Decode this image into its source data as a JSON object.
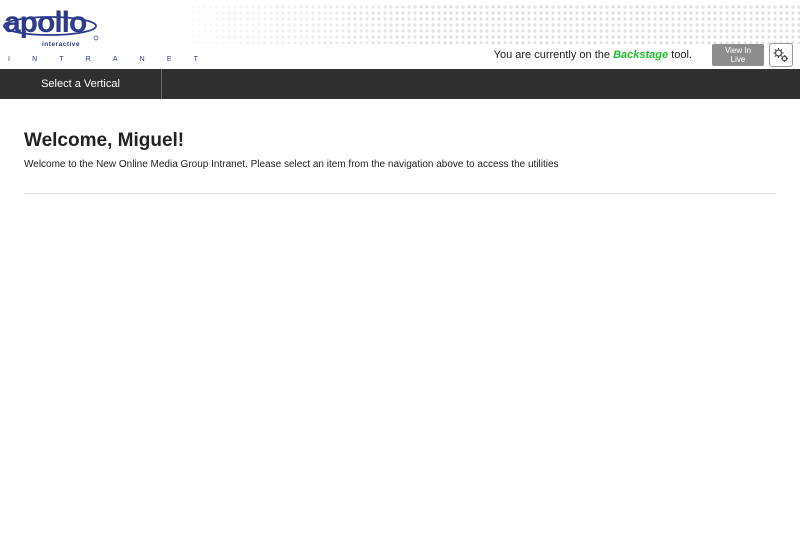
{
  "header": {
    "logo_text": "apollo",
    "logo_subtext": "interactive",
    "intranet_letters": [
      "I",
      "N",
      "T",
      "R",
      "A",
      "N",
      "E",
      "T"
    ],
    "status_prefix": "You are currently on the",
    "status_tool": "Backstage",
    "status_suffix": "tool.",
    "view_live_label": "View In Live",
    "settings_icon": "gears-icon"
  },
  "nav": {
    "items": [
      {
        "label": "Select a Vertical"
      }
    ]
  },
  "main": {
    "heading": "Welcome, Miguel!",
    "message": "Welcome to the New Online Media Group Intranet. Please select an item from the navigation above to access the utilities"
  },
  "colors": {
    "nav_bg": "#2f2f2f",
    "tool_highlight": "#1fbf2b",
    "logo_blue": "#2e3a8c",
    "button_gray": "#8d8d8d"
  }
}
